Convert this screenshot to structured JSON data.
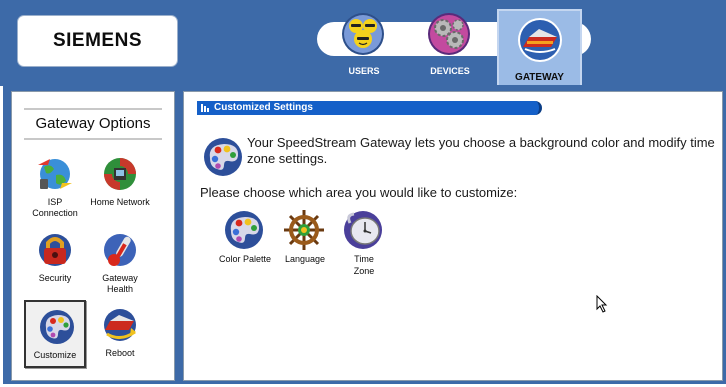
{
  "brand": {
    "logo_text": "SIEMENS"
  },
  "nav": {
    "tabs": [
      {
        "label": "USERS",
        "icon": "users-icon"
      },
      {
        "label": "DEVICES",
        "icon": "gears-icon"
      },
      {
        "label": "GATEWAY",
        "icon": "gateway-icon",
        "selected": true
      }
    ]
  },
  "sidebar": {
    "title": "Gateway Options",
    "options": [
      {
        "label": "ISP Connection",
        "icon": "globe-icon"
      },
      {
        "label": "Home Network",
        "icon": "network-icon"
      },
      {
        "label": "Security",
        "icon": "lock-icon"
      },
      {
        "label": "Gateway Health",
        "icon": "thermometer-icon"
      },
      {
        "label": "Customize",
        "icon": "palette-icon",
        "selected": true
      },
      {
        "label": "Reboot",
        "icon": "reboot-icon"
      }
    ]
  },
  "main": {
    "section_title": "Customized Settings",
    "intro": "Your SpeedStream Gateway lets you choose a background color and modify time zone settings.",
    "prompt": "Please choose which area you would like to customize:",
    "choices": [
      {
        "label": "Color Palette",
        "icon": "palette-icon"
      },
      {
        "label": "Language",
        "icon": "ship-wheel-icon"
      },
      {
        "label": "Time Zone",
        "icon": "clock-icon"
      }
    ]
  },
  "colors": {
    "header_blue": "#3d6aa8",
    "selected_tab": "#9bbbe6",
    "section_bar": "#1560c8"
  }
}
